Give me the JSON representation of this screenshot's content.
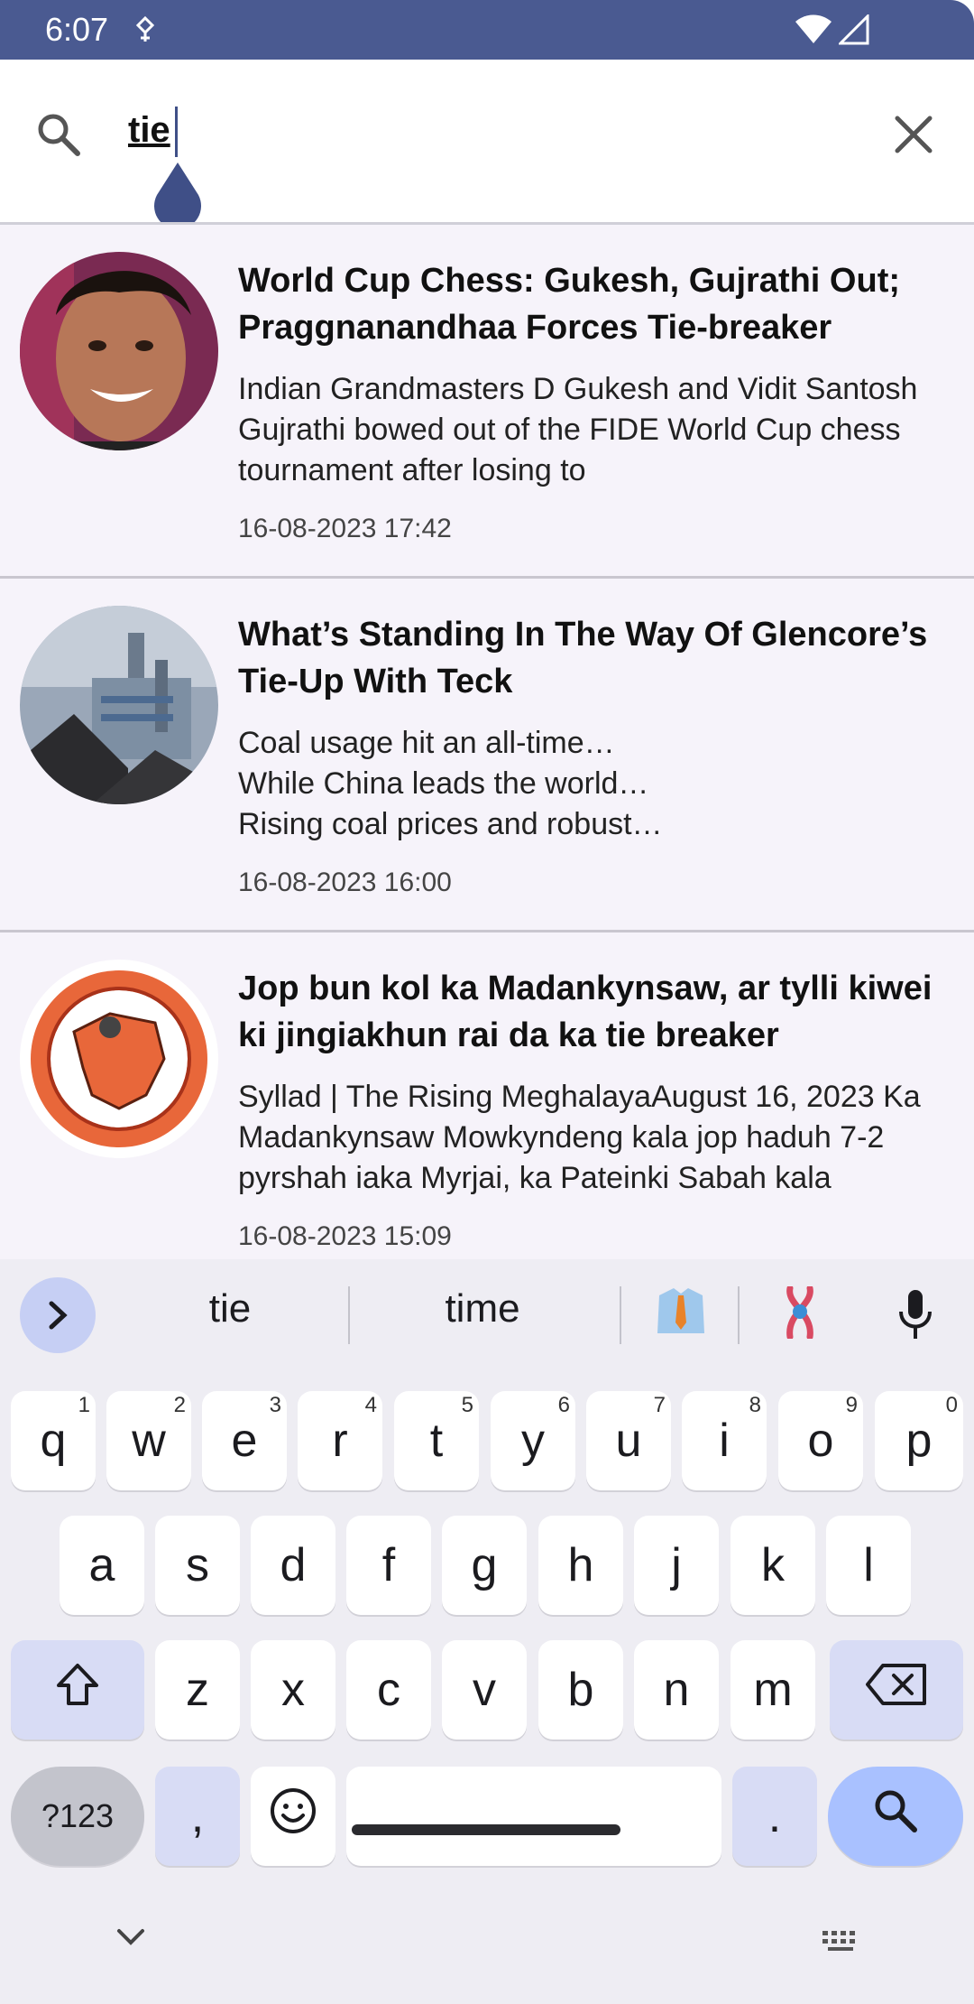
{
  "status_bar": {
    "time": "6:07"
  },
  "search": {
    "query": "tie"
  },
  "results": [
    {
      "title": "World Cup Chess: Gukesh, Gujrathi Out; Praggnanandhaa Forces Tie-breaker",
      "description": "Indian Grandmasters D Gukesh and Vidit Santosh Gujrathi bowed out of the FIDE World Cup chess tournament after losing to",
      "date": "16-08-2023 17:42"
    },
    {
      "title": "What’s Standing In The Way Of Glencore’s Tie-Up With Teck",
      "description": "Coal usage hit an all-time…\nWhile China leads the world…\nRising coal prices and robust…",
      "date": "16-08-2023 16:00"
    },
    {
      "title": "Jop bun kol ka Madankynsaw, ar tylli kiwei ki jingiakhun rai da ka tie breaker",
      "description": "Syllad | The Rising MeghalayaAugust 16, 2023 Ka Madankynsaw Mowkyndeng kala jop haduh 7-2 pyrshah iaka Myrjai, ka Pateinki Sabah kala",
      "date": "16-08-2023 15:09"
    }
  ],
  "keyboard": {
    "suggestions": [
      "tie",
      "time"
    ],
    "row1": [
      {
        "k": "q",
        "h": "1"
      },
      {
        "k": "w",
        "h": "2"
      },
      {
        "k": "e",
        "h": "3"
      },
      {
        "k": "r",
        "h": "4"
      },
      {
        "k": "t",
        "h": "5"
      },
      {
        "k": "y",
        "h": "6"
      },
      {
        "k": "u",
        "h": "7"
      },
      {
        "k": "i",
        "h": "8"
      },
      {
        "k": "o",
        "h": "9"
      },
      {
        "k": "p",
        "h": "0"
      }
    ],
    "row2": [
      "a",
      "s",
      "d",
      "f",
      "g",
      "h",
      "j",
      "k",
      "l"
    ],
    "row3": [
      "z",
      "x",
      "c",
      "v",
      "b",
      "n",
      "m"
    ],
    "symbols_label": "?123",
    "comma": ",",
    "period": "."
  }
}
